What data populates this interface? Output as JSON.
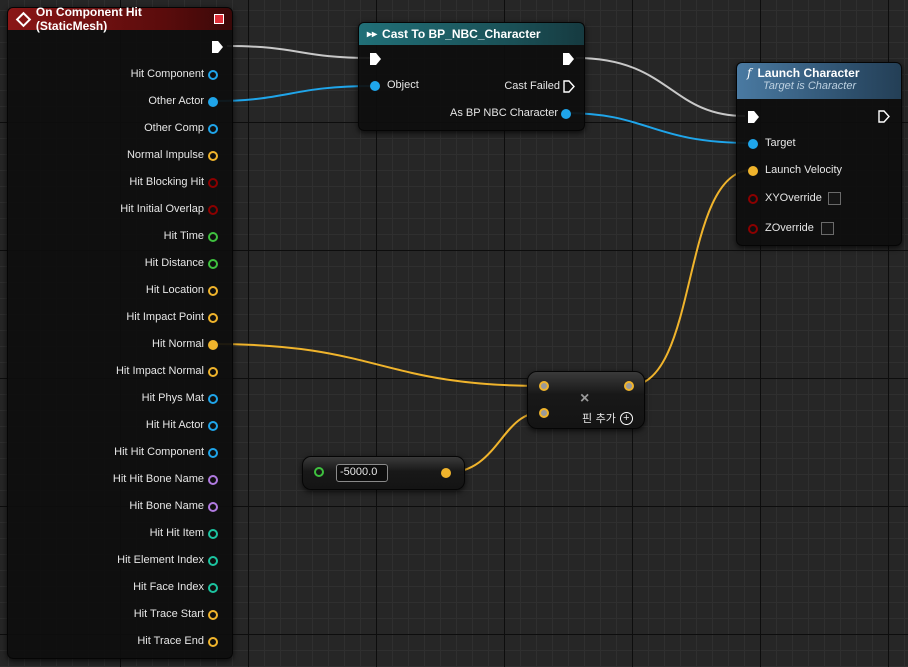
{
  "event_node": {
    "title": "On Component Hit (StaticMesh)",
    "pins": [
      {
        "label": "Hit Component",
        "color": "#1fa5ea",
        "filled": false
      },
      {
        "label": "Other Actor",
        "color": "#1fa5ea",
        "filled": true
      },
      {
        "label": "Other Comp",
        "color": "#1fa5ea",
        "filled": false
      },
      {
        "label": "Normal Impulse",
        "color": "#f0b42c",
        "filled": false
      },
      {
        "label": "Hit Blocking Hit",
        "color": "#8c0000",
        "filled": false
      },
      {
        "label": "Hit Initial Overlap",
        "color": "#8c0000",
        "filled": false
      },
      {
        "label": "Hit Time",
        "color": "#3fc13f",
        "filled": false
      },
      {
        "label": "Hit Distance",
        "color": "#3fc13f",
        "filled": false
      },
      {
        "label": "Hit Location",
        "color": "#f0b42c",
        "filled": false
      },
      {
        "label": "Hit Impact Point",
        "color": "#f0b42c",
        "filled": false
      },
      {
        "label": "Hit Normal",
        "color": "#f0b42c",
        "filled": true
      },
      {
        "label": "Hit Impact Normal",
        "color": "#f0b42c",
        "filled": false
      },
      {
        "label": "Hit Phys Mat",
        "color": "#1fa5ea",
        "filled": false
      },
      {
        "label": "Hit Hit Actor",
        "color": "#1fa5ea",
        "filled": false
      },
      {
        "label": "Hit Hit Component",
        "color": "#1fa5ea",
        "filled": false
      },
      {
        "label": "Hit Hit Bone Name",
        "color": "#b07ae0",
        "filled": false
      },
      {
        "label": "Hit Bone Name",
        "color": "#b07ae0",
        "filled": false
      },
      {
        "label": "Hit Hit Item",
        "color": "#1cc4a0",
        "filled": false
      },
      {
        "label": "Hit Element Index",
        "color": "#1cc4a0",
        "filled": false
      },
      {
        "label": "Hit Face Index",
        "color": "#1cc4a0",
        "filled": false
      },
      {
        "label": "Hit Trace Start",
        "color": "#f0b42c",
        "filled": false
      },
      {
        "label": "Hit Trace End",
        "color": "#f0b42c",
        "filled": false
      }
    ]
  },
  "cast_node": {
    "title": "Cast To BP_NBC_Character",
    "object_label": "Object",
    "cast_failed_label": "Cast Failed",
    "as_label": "As BP NBC Character"
  },
  "launch_node": {
    "icon": "function-icon",
    "title": "Launch Character",
    "subtitle": "Target is Character",
    "target_label": "Target",
    "velocity_label": "Launch Velocity",
    "xy_label": "XYOverride",
    "z_label": "ZOverride"
  },
  "multiply_node": {
    "symbol": "×",
    "add_pin_label": "핀 추가"
  },
  "float_node": {
    "value": "-5000.0"
  },
  "colors": {
    "exec": "#ffffff",
    "object": "#1fa5ea",
    "vector": "#f0b42c",
    "bool": "#8c0000",
    "float": "#3fc13f",
    "name": "#b07ae0",
    "int": "#1cc4a0",
    "event_header": "#7a1010",
    "cast_header": "#1e5b5e",
    "function_header": "#385a78"
  }
}
